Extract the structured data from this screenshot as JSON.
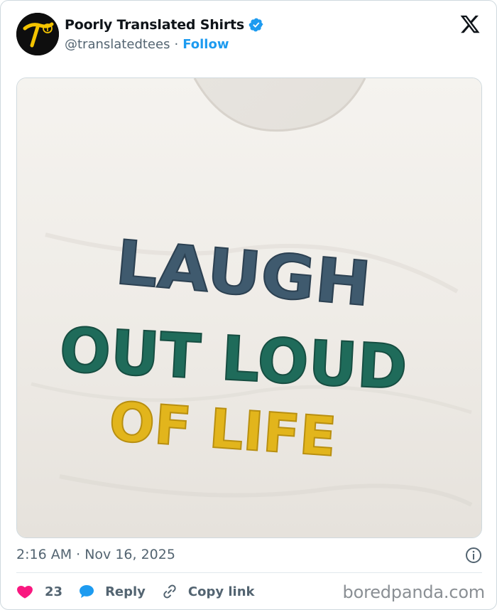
{
  "account": {
    "display_name": "Poorly Translated Shirts",
    "handle": "@translatedtees",
    "separator": "·",
    "follow_label": "Follow",
    "verified": true
  },
  "media": {
    "shirt_text_lines": [
      "LAUGH",
      "OUT LOUD",
      "OF LIFE"
    ],
    "line_colors": [
      "#3f5a6e",
      "#1f6b5a",
      "#e2b51c"
    ],
    "shirt_color": "#f1eee8"
  },
  "post": {
    "timestamp": "2:16 AM · Nov 16, 2025"
  },
  "actions": {
    "like_count": "23",
    "reply_label": "Reply",
    "copy_link_label": "Copy link"
  },
  "icons": {
    "avatar": "logo-avatar-icon",
    "verified": "verified-badge-icon",
    "x": "x-logo-icon",
    "info": "info-icon",
    "like": "heart-icon",
    "reply": "speech-bubble-icon",
    "copy": "link-icon"
  },
  "colors": {
    "accent": "#1d9bf0",
    "like": "#f91880",
    "muted": "#536471"
  },
  "watermark": "boredpanda.com"
}
